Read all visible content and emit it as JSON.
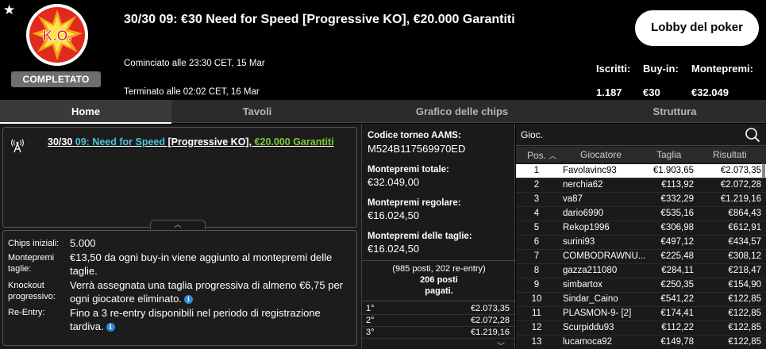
{
  "header": {
    "badge_label": "COMPLETATO",
    "badge_logo_text": "K.O.",
    "title": "30/30 09: €30 Need for Speed [Progressive KO], €20.000 Garantiti",
    "started": "Cominciato alle 23:30 CET, 15 Mar",
    "ended": "Terminato alle 02:02 CET, 16 Mar",
    "lobby_button": "Lobby del poker",
    "stats": [
      {
        "label": "Iscritti:",
        "value": "1.187"
      },
      {
        "label": "Buy-in:",
        "value": "€30"
      },
      {
        "label": "Montepremi:",
        "value": "€32.049"
      }
    ]
  },
  "tabs": [
    "Home",
    "Tavoli",
    "Grafico delle chips",
    "Struttura"
  ],
  "news": {
    "part1": "30/30 ",
    "part2": "09: Need for Speed",
    "part3": " [Progressive KO], ",
    "part4": "€20.000 Garantiti"
  },
  "details": [
    {
      "label": "Chips iniziali:",
      "value": "5.000"
    },
    {
      "label": "Montepremi taglie:",
      "value": "€13,50 da ogni buy-in viene aggiunto al montepremi delle taglie."
    },
    {
      "label": "Knockout progressivo:",
      "value": "Verrà assegnata una taglia progressiva di almeno €6,75 per ogni giocatore eliminato."
    },
    {
      "label": "Re-Entry:",
      "value": "Fino a 3 re-entry disponibili nel periodo di registrazione tardiva."
    }
  ],
  "middle": {
    "code_label": "Codice torneo AAMS:",
    "code_value": "M524B117569970ED",
    "total_label": "Montepremi totale:",
    "total_value": "€32.049,00",
    "regular_label": "Montepremi regolare:",
    "regular_value": "€16.024,50",
    "bounty_label": "Montepremi delle taglie:",
    "bounty_value": "€16.024,50",
    "places_note": "(985 posti, 202 re-entry)",
    "places_paid_1": "206 posti",
    "places_paid_2": "pagati.",
    "prizes": [
      {
        "place": "1°",
        "amount": "€2.073,35"
      },
      {
        "place": "2°",
        "amount": "€2.072,28"
      },
      {
        "place": "3°",
        "amount": "€1.219,16"
      }
    ]
  },
  "players": {
    "search_placeholder": "Gioc.",
    "columns": [
      "Pos.",
      "Giocatore",
      "Taglia",
      "Risultati"
    ],
    "rows": [
      {
        "pos": "1",
        "name": "Favolavinc93",
        "bounty": "€1.903,65",
        "result": "€2.073,35"
      },
      {
        "pos": "2",
        "name": "nerchia62",
        "bounty": "€113,92",
        "result": "€2.072,28"
      },
      {
        "pos": "3",
        "name": "va87",
        "bounty": "€332,29",
        "result": "€1.219,16"
      },
      {
        "pos": "4",
        "name": "dario6990",
        "bounty": "€535,16",
        "result": "€864,43"
      },
      {
        "pos": "5",
        "name": "Rekop1996",
        "bounty": "€306,98",
        "result": "€612,91"
      },
      {
        "pos": "6",
        "name": "surini93",
        "bounty": "€497,12",
        "result": "€434,57"
      },
      {
        "pos": "7",
        "name": "COMBODRAWNU...",
        "bounty": "€225,48",
        "result": "€308,12"
      },
      {
        "pos": "8",
        "name": "gazza211080",
        "bounty": "€284,11",
        "result": "€218,47"
      },
      {
        "pos": "9",
        "name": "simbartox",
        "bounty": "€250,35",
        "result": "€154,90"
      },
      {
        "pos": "10",
        "name": "Sindar_Caino",
        "bounty": "€541,22",
        "result": "€122,85"
      },
      {
        "pos": "11",
        "name": "PLASMON-9- [2]",
        "bounty": "€174,41",
        "result": "€122,85"
      },
      {
        "pos": "12",
        "name": "Scurpiddu93",
        "bounty": "€112,22",
        "result": "€122,85"
      },
      {
        "pos": "13",
        "name": "lucamoca92",
        "bounty": "€149,78",
        "result": "€122,85"
      }
    ]
  }
}
